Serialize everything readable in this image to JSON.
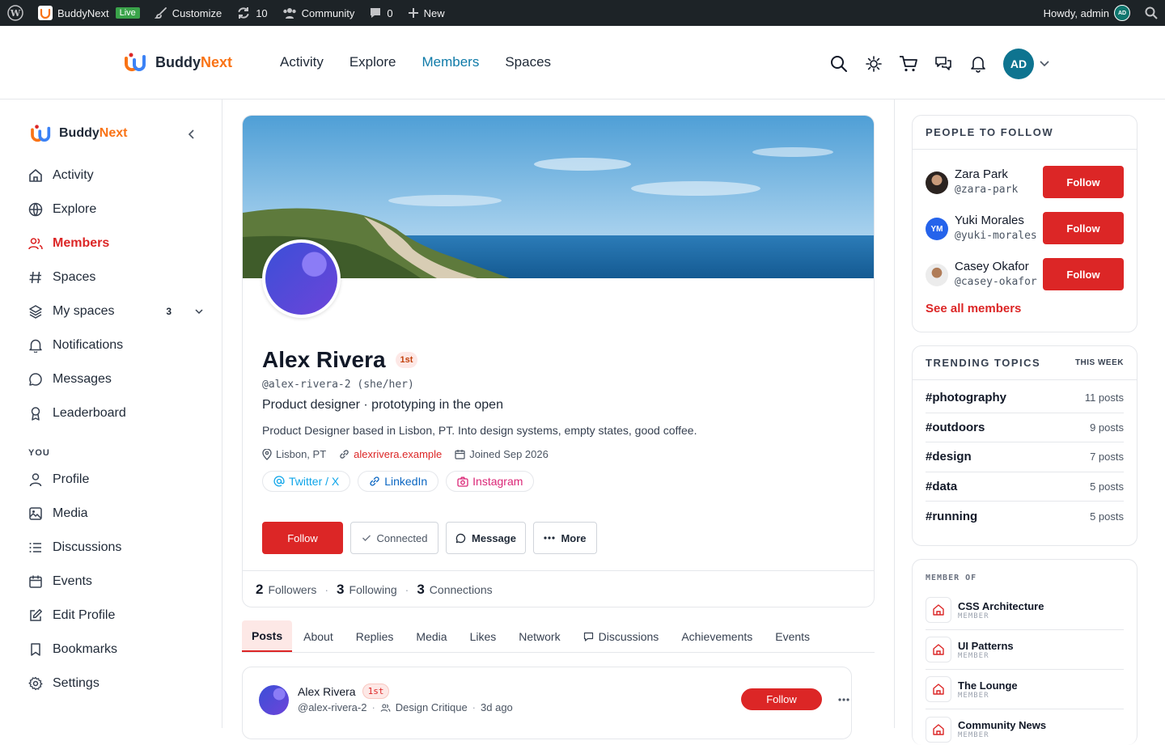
{
  "adminbar": {
    "site_name": "BuddyNext",
    "live_badge": "Live",
    "customize": "Customize",
    "updates_count": "10",
    "community": "Community",
    "comments_count": "0",
    "new": "New",
    "howdy": "Howdy, admin",
    "avatar_initials": "AD"
  },
  "header": {
    "brand_part1": "Buddy",
    "brand_part2": "Next",
    "nav": [
      "Activity",
      "Explore",
      "Members",
      "Spaces"
    ],
    "active_nav": "Members",
    "avatar_initials": "AD"
  },
  "sidebar": {
    "brand_part1": "Buddy",
    "brand_part2": "Next",
    "items": [
      {
        "label": "Activity",
        "icon": "home-icon"
      },
      {
        "label": "Explore",
        "icon": "globe-icon"
      },
      {
        "label": "Members",
        "icon": "users-icon",
        "active": true
      },
      {
        "label": "Spaces",
        "icon": "hash-icon"
      },
      {
        "label": "My spaces",
        "icon": "layers-icon",
        "count": "3"
      },
      {
        "label": "Notifications",
        "icon": "bell-icon"
      },
      {
        "label": "Messages",
        "icon": "message-icon"
      },
      {
        "label": "Leaderboard",
        "icon": "award-icon"
      }
    ],
    "section_you": "YOU",
    "you_items": [
      {
        "label": "Profile",
        "icon": "user-icon"
      },
      {
        "label": "Media",
        "icon": "image-icon"
      },
      {
        "label": "Discussions",
        "icon": "list-icon"
      },
      {
        "label": "Events",
        "icon": "calendar-icon"
      },
      {
        "label": "Edit Profile",
        "icon": "edit-icon"
      },
      {
        "label": "Bookmarks",
        "icon": "bookmark-icon"
      },
      {
        "label": "Settings",
        "icon": "gear-icon"
      }
    ]
  },
  "profile": {
    "name": "Alex Rivera",
    "degree_badge": "1st",
    "handle": "@alex-rivera-2 (she/her)",
    "tagline": "Product designer · prototyping in the open",
    "bio": "Product Designer based in Lisbon, PT. Into design systems, empty states, good coffee.",
    "location": "Lisbon, PT",
    "website": "alexrivera.example",
    "joined": "Joined Sep 2026",
    "social": [
      "Twitter / X",
      "LinkedIn",
      "Instagram"
    ],
    "actions": {
      "follow": "Follow",
      "connected": "Connected",
      "message": "Message",
      "more": "More"
    },
    "stats": {
      "followers_count": "2",
      "followers_label": "Followers",
      "following_count": "3",
      "following_label": "Following",
      "connections_count": "3",
      "connections_label": "Connections"
    }
  },
  "tabs": [
    "Posts",
    "About",
    "Replies",
    "Media",
    "Likes",
    "Network",
    "Discussions",
    "Achievements",
    "Events"
  ],
  "active_tab": "Posts",
  "post": {
    "author": "Alex Rivera",
    "badge": "1st",
    "handle": "@alex-rivera-2",
    "space": "Design Critique",
    "time": "3d ago",
    "follow": "Follow"
  },
  "people_to_follow": {
    "title": "PEOPLE TO FOLLOW",
    "people": [
      {
        "name": "Zara Park",
        "handle": "@zara-park",
        "button": "Follow"
      },
      {
        "name": "Yuki Morales",
        "handle": "@yuki-morales",
        "button": "Follow",
        "initials": "YM"
      },
      {
        "name": "Casey Okafor",
        "handle": "@casey-okafor",
        "button": "Follow"
      }
    ],
    "see_all": "See all members"
  },
  "trending": {
    "title": "TRENDING TOPICS",
    "period": "THIS WEEK",
    "topics": [
      {
        "tag": "#photography",
        "count": "11 posts"
      },
      {
        "tag": "#outdoors",
        "count": "9 posts"
      },
      {
        "tag": "#design",
        "count": "7 posts"
      },
      {
        "tag": "#data",
        "count": "5 posts"
      },
      {
        "tag": "#running",
        "count": "5 posts"
      }
    ]
  },
  "member_of": {
    "title": "MEMBER OF",
    "spaces": [
      {
        "name": "CSS Architecture",
        "role": "MEMBER"
      },
      {
        "name": "UI Patterns",
        "role": "MEMBER"
      },
      {
        "name": "The Lounge",
        "role": "MEMBER"
      },
      {
        "name": "Community News",
        "role": "MEMBER"
      }
    ]
  },
  "colors": {
    "accent": "#dc2626",
    "nav_active": "#0e7aa8",
    "brand_orange": "#f97316",
    "admin_bar": "#1d2327"
  }
}
